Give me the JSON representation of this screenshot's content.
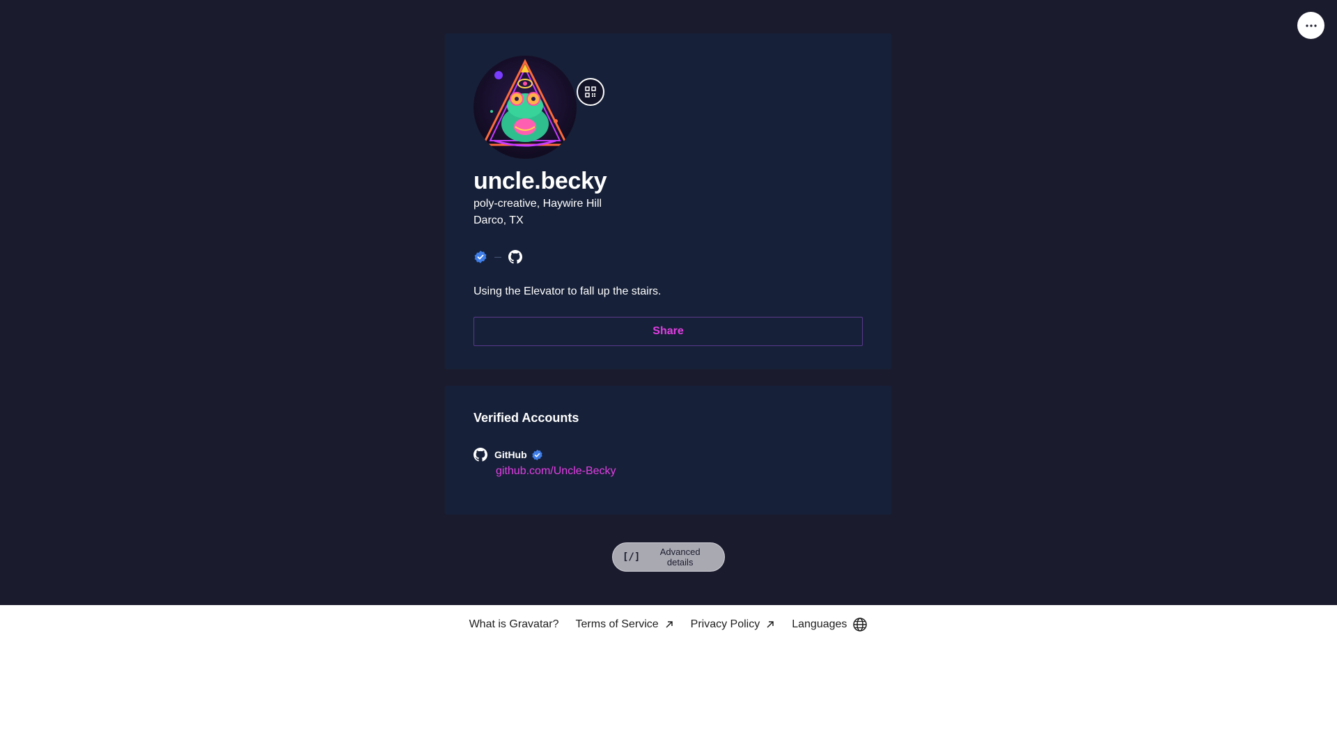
{
  "profile": {
    "display_name": "uncle.becky",
    "job": "poly-creative, Haywire Hill",
    "location": "Darco, TX",
    "about": "Using the Elevator to fall up the stairs.",
    "share_label": "Share"
  },
  "verified": {
    "title": "Verified Accounts",
    "accounts": [
      {
        "service": "GitHub",
        "url": "github.com/Uncle-Becky"
      }
    ]
  },
  "advanced": {
    "icon": "[/]",
    "label": "Advanced details"
  },
  "footer": {
    "what_is": "What is Gravatar?",
    "terms": "Terms of Service",
    "privacy": "Privacy Policy",
    "languages": "Languages"
  },
  "colors": {
    "background": "#1b1b2e",
    "card": "#162038",
    "accent": "#e13fe3",
    "verified_blue": "#3f7ee8"
  },
  "icons": [
    "more-icon",
    "qr-code-icon",
    "verified-badge-icon",
    "github-icon",
    "external-link-icon",
    "globe-icon"
  ]
}
